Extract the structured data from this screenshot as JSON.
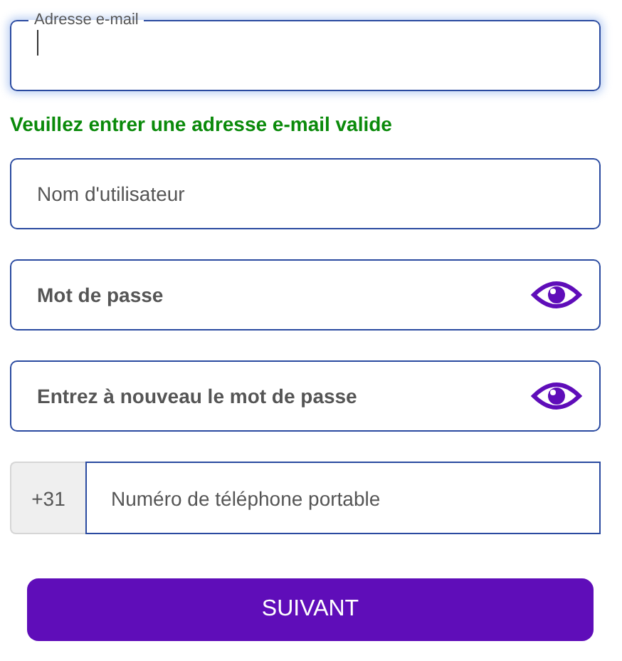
{
  "email_field": {
    "label": "Adresse e-mail",
    "focused": true
  },
  "validation_message": "Veuillez entrer une adresse e-mail valide",
  "fields": [
    {
      "kind": "text",
      "placeholder": "Nom d'utilisateur"
    },
    {
      "kind": "password",
      "placeholder": "Mot de passe"
    },
    {
      "kind": "password",
      "placeholder": "Entrez à nouveau le mot de passe"
    }
  ],
  "phone": {
    "prefix": "+31",
    "placeholder": "Numéro de téléphone portable"
  },
  "next_button": "SUIVANT"
}
